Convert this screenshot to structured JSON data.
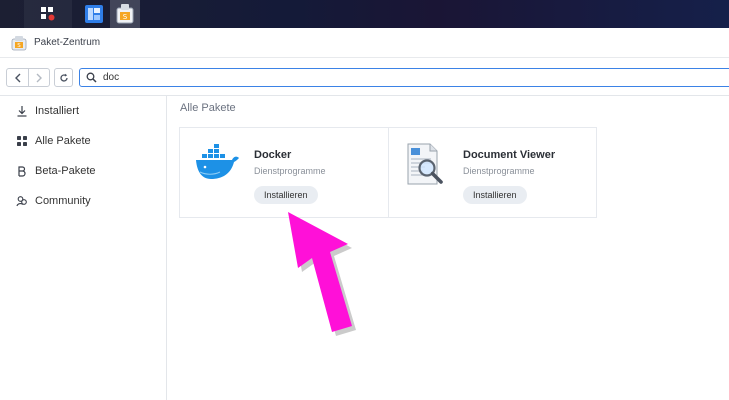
{
  "window": {
    "title": "Paket-Zentrum"
  },
  "search": {
    "value": "doc"
  },
  "sidebar": {
    "items": [
      {
        "label": "Installiert",
        "icon": "download-icon"
      },
      {
        "label": "Alle Pakete",
        "icon": "grid-icon"
      },
      {
        "label": "Beta-Pakete",
        "icon": "beta-icon"
      },
      {
        "label": "Community",
        "icon": "community-icon"
      }
    ]
  },
  "main": {
    "section_title": "Alle Pakete",
    "packages": [
      {
        "name": "Docker",
        "category": "Dienstprogramme",
        "action": "Installieren",
        "icon": "docker-whale-icon"
      },
      {
        "name": "Document Viewer",
        "category": "Dienstprogramme",
        "action": "Installieren",
        "icon": "document-viewer-icon"
      }
    ]
  },
  "colors": {
    "accent": "#3b82e6",
    "arrow": "#ff10d8",
    "docker_blue": "#1d91e6"
  }
}
